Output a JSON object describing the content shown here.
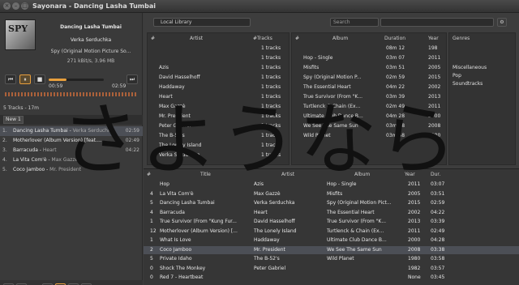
{
  "window": {
    "title": "Sayonara - Dancing Lasha Tumbai"
  },
  "now_playing": {
    "cover_text": "SPY",
    "title": "Dancing Lasha Tumbai",
    "artist": "Verka Serduchka",
    "album": "Spy (Original Motion Picture So...",
    "bitrate": "271 kBit/s, 3.96 MB",
    "time_elapsed": "00:59",
    "time_total": "02:59",
    "progress": 0.33
  },
  "transport": {
    "prev": "⏮",
    "pause": "⏸",
    "stop": "■",
    "next": "⏭"
  },
  "playlist": {
    "info": "5 Tracks - 17m",
    "tab_label": "New 1",
    "items": [
      {
        "num": "1.",
        "title": "Dancing Lasha Tumbai",
        "artist": "Verka Serduchka",
        "duration": "02:59"
      },
      {
        "num": "2.",
        "title": "Motherlover (Album Version) [feat....",
        "artist": "",
        "duration": "02:49"
      },
      {
        "num": "3.",
        "title": "Barracuda",
        "artist": "Heart",
        "duration": "04:22"
      },
      {
        "num": "4.",
        "title": "La Vita Com'è",
        "artist": "Max Gazzè",
        "duration": ""
      },
      {
        "num": "5.",
        "title": "Coco Jamboo",
        "artist": "Mr. President",
        "duration": ""
      }
    ]
  },
  "bottom_icons": [
    "⌘",
    "⤴",
    "⤮",
    "♪",
    "≡",
    "+"
  ],
  "library": {
    "source": "Local Library",
    "search_placeholder": "Search",
    "artist_header": {
      "num": "#",
      "name": "Artist",
      "tracks": "#Tracks"
    },
    "artists": [
      {
        "name": "",
        "tracks": "1 tracks"
      },
      {
        "name": "",
        "tracks": "1 tracks"
      },
      {
        "name": "Azis",
        "tracks": "1 tracks"
      },
      {
        "name": "David Hasselhoff",
        "tracks": "1 tracks"
      },
      {
        "name": "Haddaway",
        "tracks": "1 tracks"
      },
      {
        "name": "Heart",
        "tracks": "1 tracks"
      },
      {
        "name": "Max Gazzè",
        "tracks": "1 tracks"
      },
      {
        "name": "Mr. President",
        "tracks": "1 tracks"
      },
      {
        "name": "Peter Gabriel",
        "tracks": "1 tracks"
      },
      {
        "name": "The B-52's",
        "tracks": "1 tracks"
      },
      {
        "name": "The Lonely Island",
        "tracks": "1 tracks"
      },
      {
        "name": "Verka Serduchka",
        "tracks": "1 tracks"
      }
    ],
    "album_header": {
      "num": "#",
      "name": "Album",
      "duration": "Duration",
      "year": "Year"
    },
    "albums": [
      {
        "name": "",
        "duration": "08m 12",
        "year": "198"
      },
      {
        "name": "Hop - Single",
        "duration": "03m 07",
        "year": "2011"
      },
      {
        "name": "Misfits",
        "duration": "03m 51",
        "year": "2005"
      },
      {
        "name": "Spy (Original Motion P...",
        "duration": "02m 59",
        "year": "2015"
      },
      {
        "name": "The Essential Heart",
        "duration": "04m 22",
        "year": "2002"
      },
      {
        "name": "True Survivor (From \"K...",
        "duration": "03m 39",
        "year": "2013"
      },
      {
        "name": "Turtlenck & Chain (Ex...",
        "duration": "02m 49",
        "year": "2011"
      },
      {
        "name": "Ultimate Club Dance B...",
        "duration": "04m 28",
        "year": "2000"
      },
      {
        "name": "We See The Same Sun",
        "duration": "03m 38",
        "year": "2008"
      },
      {
        "name": "Wild Planet",
        "duration": "03m 58",
        "year": "1980"
      }
    ],
    "genres_header": "Genres",
    "genres": [
      "Miscellaneous",
      "Pop",
      "Soundtracks"
    ],
    "tracks_header": {
      "num": "#",
      "title": "Title",
      "artist": "Artist",
      "album": "Album",
      "year": "Year",
      "duration": "Dur."
    },
    "tracks": [
      {
        "num": "",
        "title": "Hop",
        "artist": "Azis",
        "album": "Hop - Single",
        "year": "2011",
        "duration": "03:07"
      },
      {
        "num": "4",
        "title": "La Vita Com'è",
        "artist": "Max Gazzè",
        "album": "Misfits",
        "year": "2005",
        "duration": "03:51"
      },
      {
        "num": "5",
        "title": "Dancing Lasha Tumbai",
        "artist": "Verka Serduchka",
        "album": "Spy (Original Motion Pict...",
        "year": "2015",
        "duration": "02:59"
      },
      {
        "num": "4",
        "title": "Barracuda",
        "artist": "Heart",
        "album": "The Essential Heart",
        "year": "2002",
        "duration": "04:22"
      },
      {
        "num": "1",
        "title": "True Survivor (From \"Kung Fur...",
        "artist": "David Hasselhoff",
        "album": "True Survivor (From \"K...",
        "year": "2013",
        "duration": "03:39"
      },
      {
        "num": "12",
        "title": "Motherlover (Album Version) [...",
        "artist": "The Lonely Island",
        "album": "Turtlenck & Chain (Ex...",
        "year": "2011",
        "duration": "02:49"
      },
      {
        "num": "1",
        "title": "What Is Love",
        "artist": "Haddaway",
        "album": "Ultimate Club Dance B...",
        "year": "2000",
        "duration": "04:28"
      },
      {
        "num": "2",
        "title": "Coco Jamboo",
        "artist": "Mr. President",
        "album": "We See The Same Sun",
        "year": "2008",
        "duration": "03:38"
      },
      {
        "num": "5",
        "title": "Private Idaho",
        "artist": "The B-52's",
        "album": "Wild Planet",
        "year": "1980",
        "duration": "03:58"
      },
      {
        "num": "0",
        "title": "Shock The Monkey",
        "artist": "Peter Gabriel",
        "album": "",
        "year": "1982",
        "duration": "03:57"
      },
      {
        "num": "0",
        "title": "Red 7 - Heartbeat",
        "artist": "",
        "album": "",
        "year": "None",
        "duration": "03:45"
      }
    ]
  },
  "overlay_text": "さようなら",
  "colors": {
    "accent": "#e89f3c",
    "selection": "#4c4f56"
  }
}
